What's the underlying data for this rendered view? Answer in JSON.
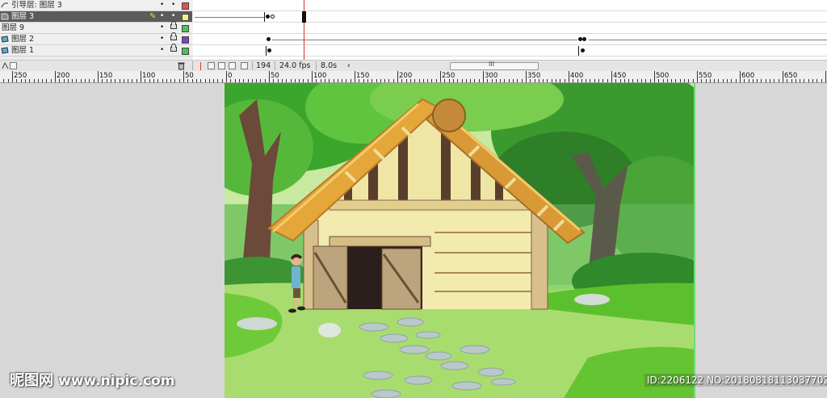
{
  "timeline": {
    "layers": [
      {
        "name": "引导层: 图层 3",
        "swatch": "#e05050",
        "selected": false,
        "locked": false,
        "icon": "guide-layer-icon"
      },
      {
        "name": "图层 3",
        "swatch": "#f0f080",
        "selected": true,
        "locked": false,
        "icon": "layer-icon"
      },
      {
        "name": "图层 9",
        "swatch": "#50c060",
        "selected": false,
        "locked": true,
        "icon": "folder-layer-icon"
      },
      {
        "name": "图层 2",
        "swatch": "#8040c0",
        "selected": false,
        "locked": true,
        "icon": "guided-layer-icon"
      },
      {
        "name": "图层 1",
        "swatch": "#50c050",
        "selected": false,
        "locked": true,
        "icon": "guided-layer-icon"
      }
    ],
    "status": {
      "current_frame": "194",
      "frame_rate": "24.0 fps",
      "elapsed_time": "8.0s",
      "scroll_grip": "III"
    }
  },
  "ruler": {
    "labels": [
      "250",
      "200",
      "150",
      "100",
      "50",
      "0",
      "50",
      "100",
      "150",
      "200",
      "250",
      "300",
      "350",
      "400",
      "450",
      "500",
      "550",
      "600",
      "650"
    ]
  },
  "watermark": {
    "brand": "昵图网",
    "url": "www.nipic.com",
    "id_text": "ID:2206122 NO:20180818113037702000"
  },
  "colors": {
    "playhead": "#d8342c",
    "selected_layer": "#5b5b5b",
    "workspace": "#d7d7d7"
  }
}
